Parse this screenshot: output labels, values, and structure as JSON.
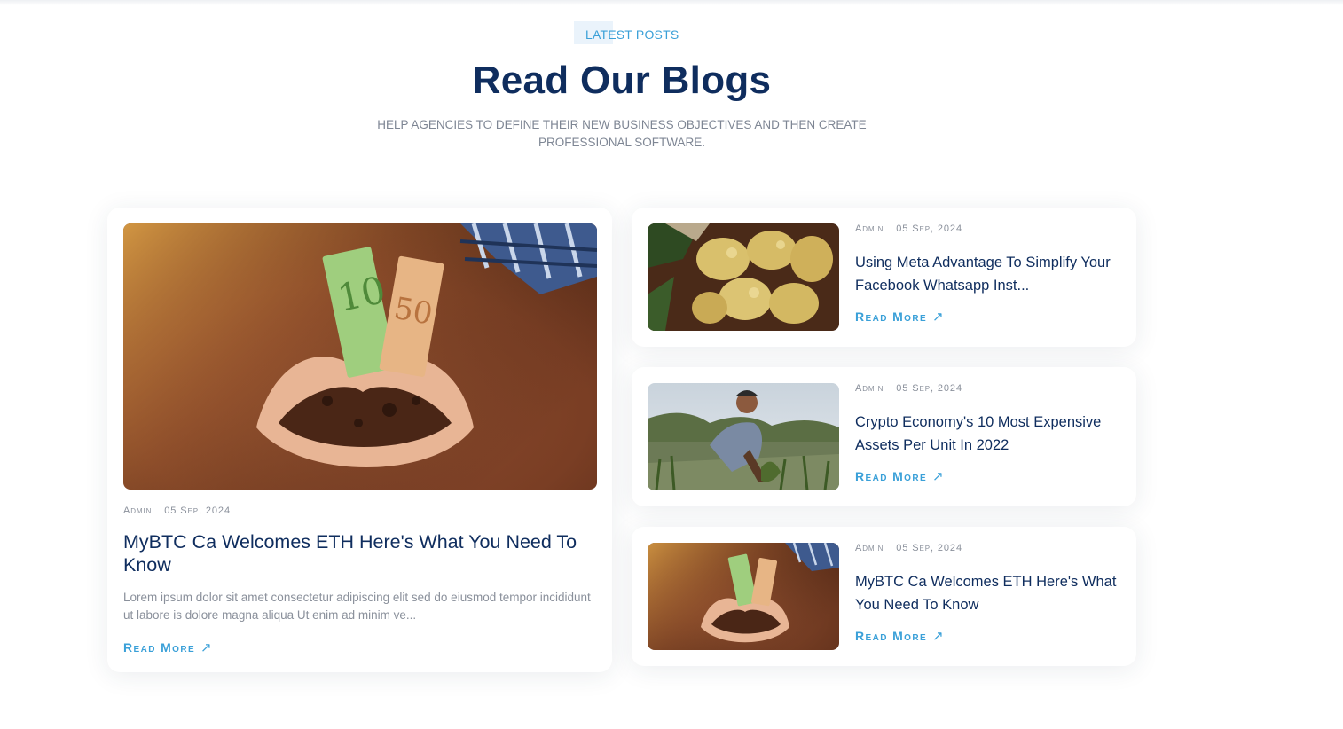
{
  "section": {
    "tag": "LATEST POSTS",
    "heading": "Read Our Blogs",
    "subtext": "HELP AGENCIES TO DEFINE THEIR NEW BUSINESS OBJECTIVES AND THEN CREATE PROFESSIONAL SOFTWARE."
  },
  "featured": {
    "author": "Admin",
    "date": "05 Sep, 2024",
    "title": "MyBTC Ca Welcomes ETH Here's What You Need To Know",
    "excerpt": "Lorem ipsum dolor sit amet consectetur adipiscing elit sed do eiusmod tempor incididunt ut labore is dolore magna aliqua Ut enim ad minim ve...",
    "read_more": "Read More",
    "image": "hands-soil-money-image"
  },
  "posts": [
    {
      "author": "Admin",
      "date": "05 Sep, 2024",
      "title": "Using Meta Advantage To Simplify Your Facebook Whatsapp Inst...",
      "read_more": "Read More",
      "image": "potatoes-image"
    },
    {
      "author": "Admin",
      "date": "05 Sep, 2024",
      "title": "Crypto Economy's 10 Most Expensive Assets Per Unit In 2022",
      "read_more": "Read More",
      "image": "farmer-field-image"
    },
    {
      "author": "Admin",
      "date": "05 Sep, 2024",
      "title": "MyBTC Ca Welcomes ETH Here's What You Need To Know",
      "read_more": "Read More",
      "image": "hands-soil-money-image"
    }
  ],
  "icons": {
    "read_more": "arrow-up-right-icon"
  },
  "colors": {
    "heading": "#0f2d5e",
    "accent": "#3aa0d8",
    "muted": "#8a909b"
  }
}
